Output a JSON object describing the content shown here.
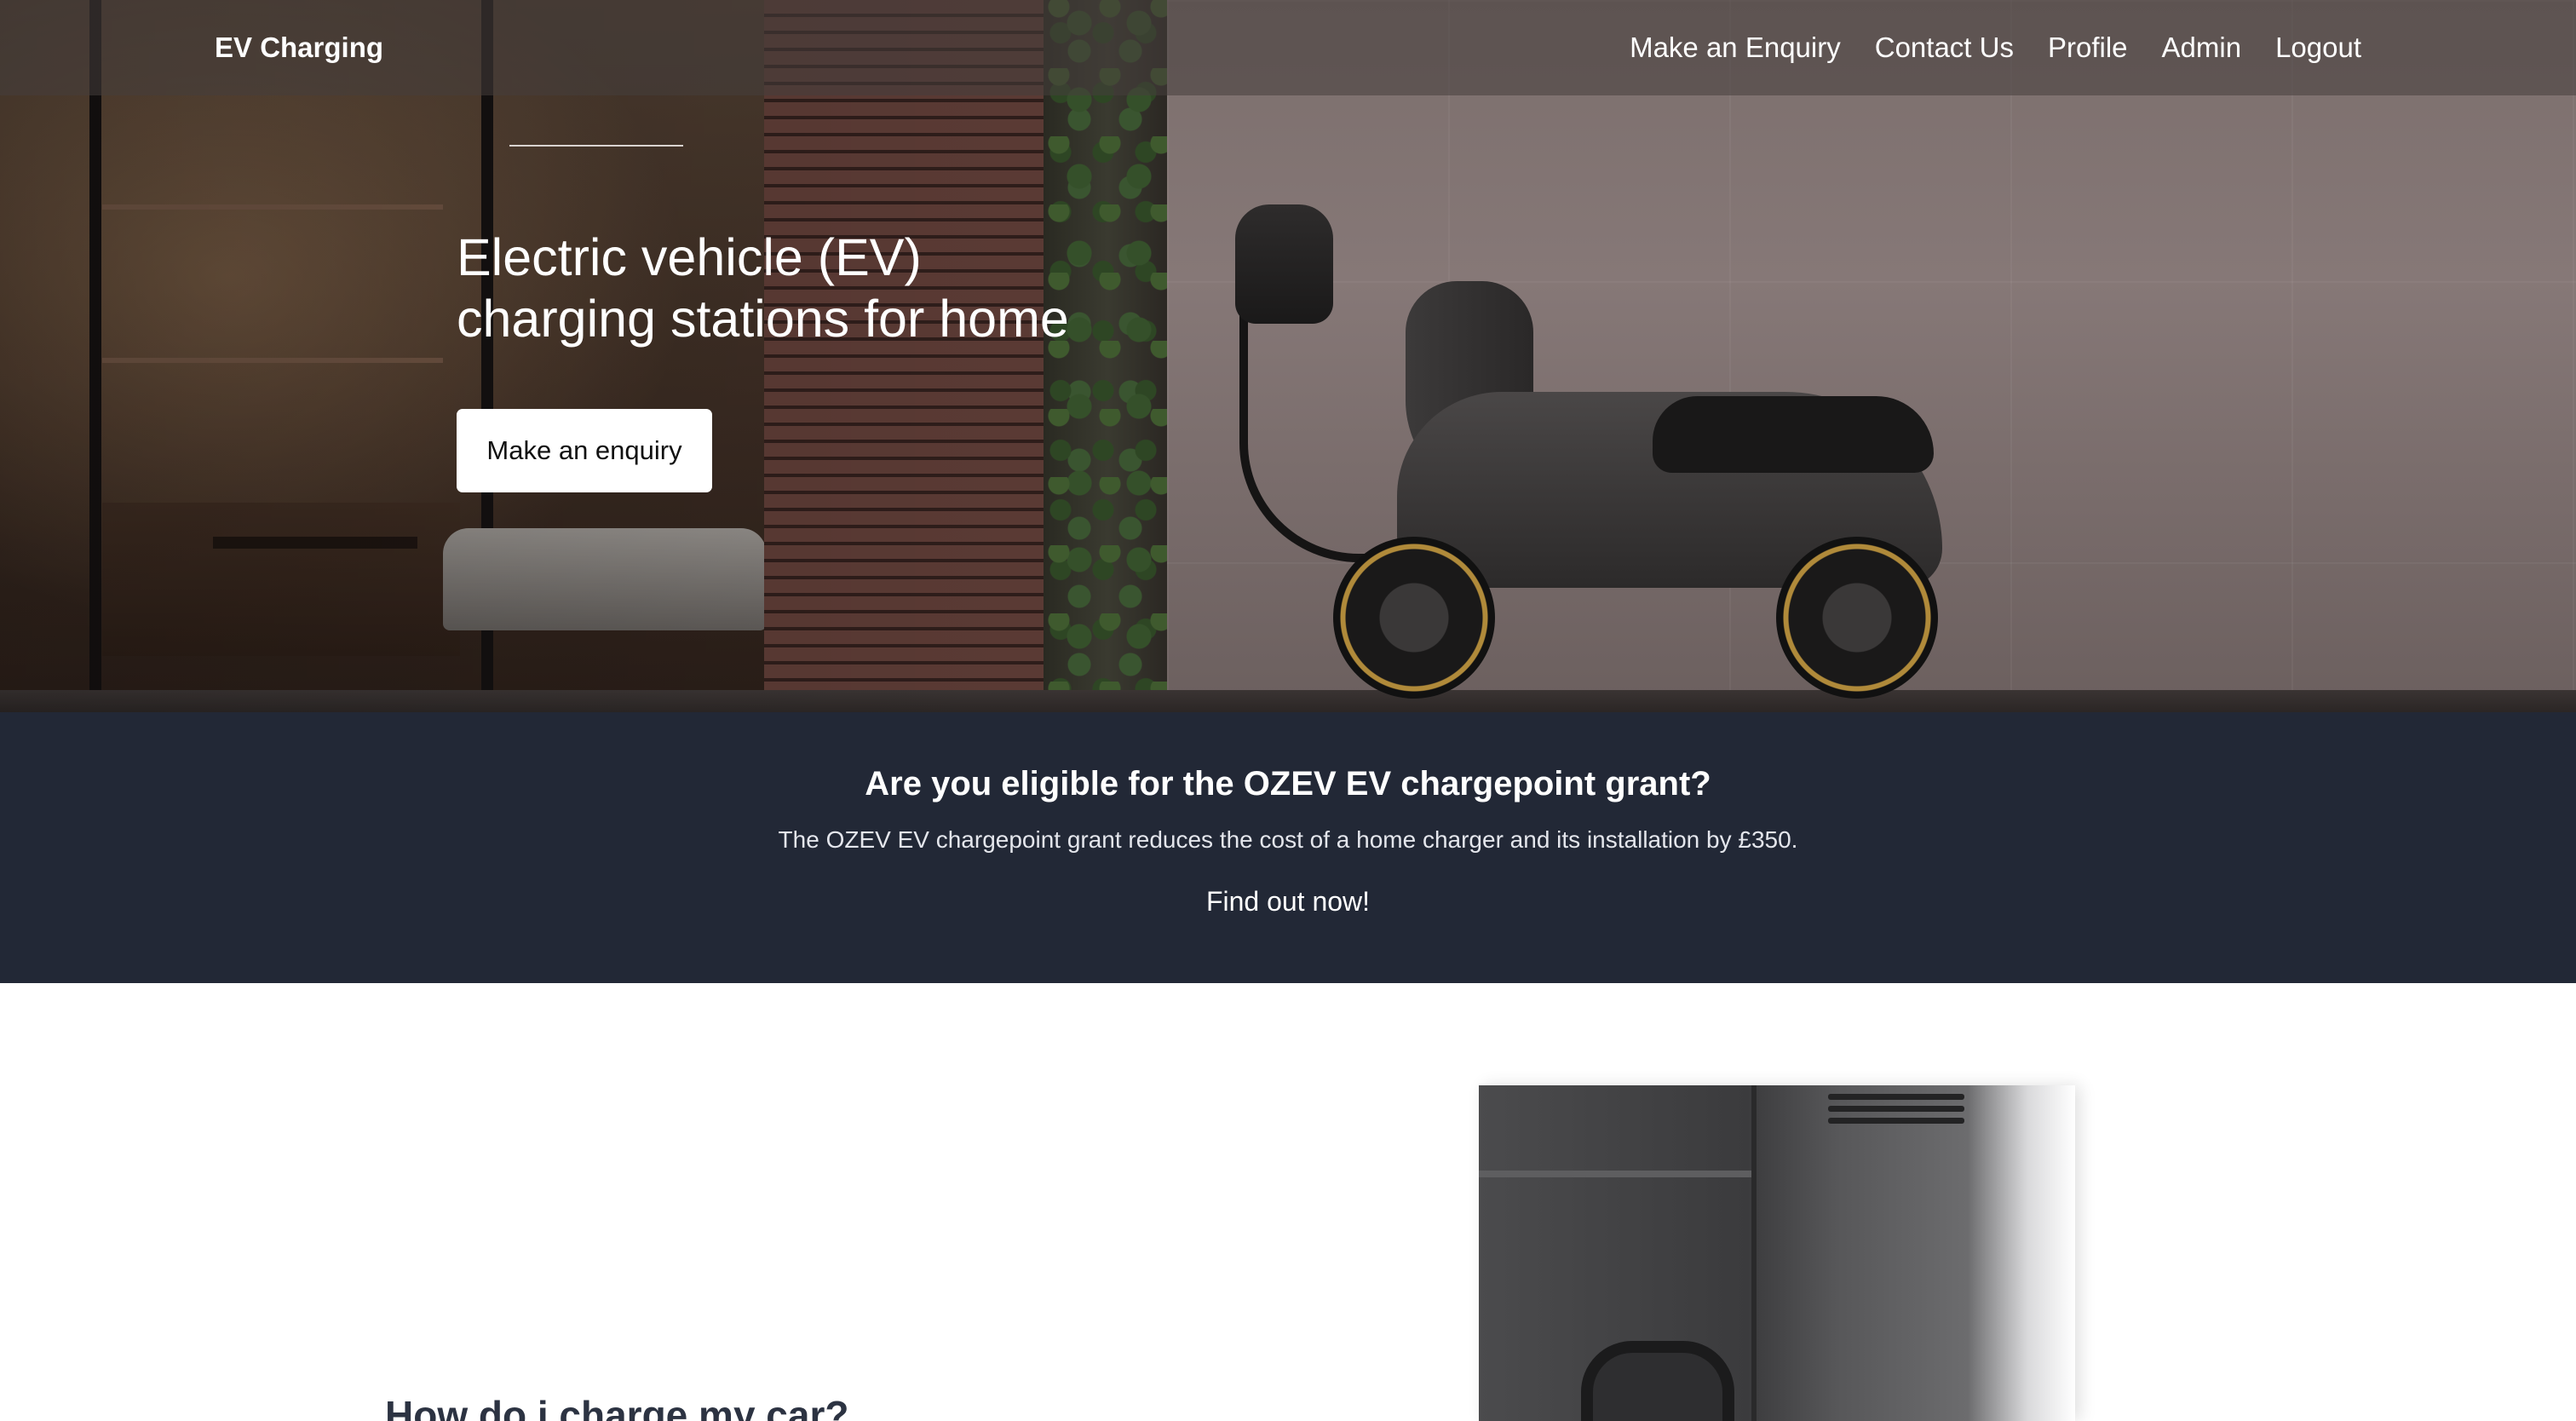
{
  "navbar": {
    "brand": "EV Charging",
    "links": [
      {
        "label": "Make an Enquiry"
      },
      {
        "label": "Contact Us"
      },
      {
        "label": "Profile"
      },
      {
        "label": "Admin"
      },
      {
        "label": "Logout"
      }
    ]
  },
  "hero": {
    "title_line1": "Electric vehicle (EV)",
    "title_line2": "charging stations for home",
    "cta_label": "Make an enquiry"
  },
  "grant": {
    "title": "Are you eligible for the OZEV EV chargepoint grant?",
    "text": "The OZEV EV chargepoint grant reduces the cost of a home charger and its installation by £350.",
    "link_label": "Find out now!"
  },
  "section": {
    "heading": "How do i charge my car?"
  },
  "colors": {
    "grant_band": "#222836",
    "heading_text": "#2c3342",
    "button_bg": "#ffffff"
  }
}
